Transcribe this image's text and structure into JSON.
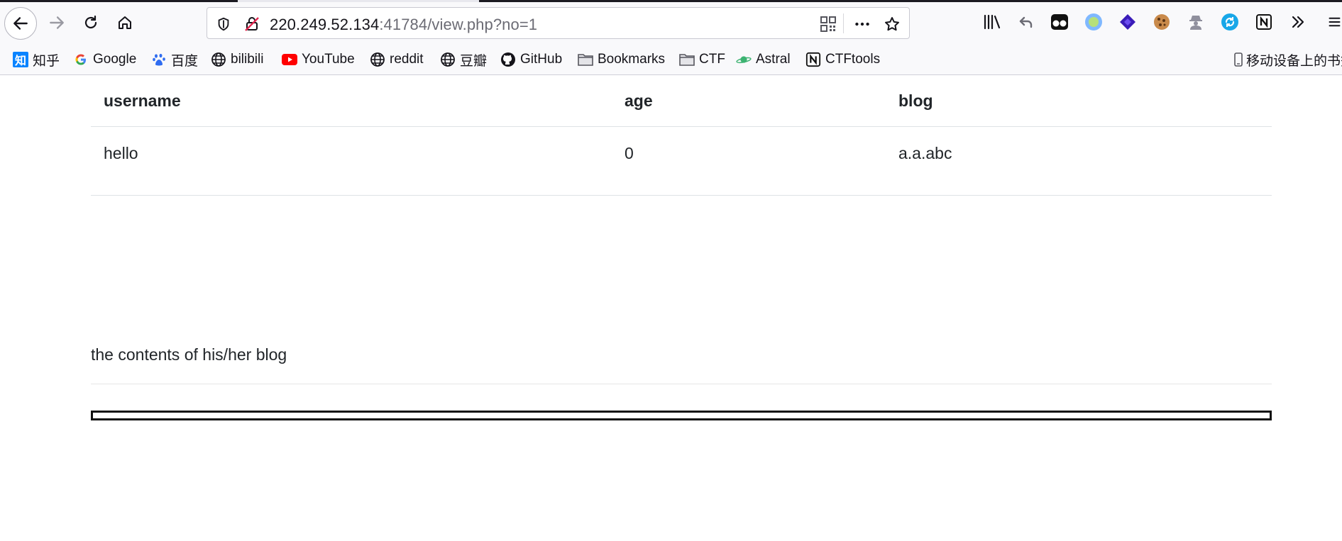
{
  "browser": {
    "url_host": "220.249.52.134",
    "url_rest": ":41784/view.php?no=1",
    "bookmarks": [
      {
        "label": "知乎",
        "icon": "zhihu-icon"
      },
      {
        "label": "Google",
        "icon": "google-icon"
      },
      {
        "label": "百度",
        "icon": "baidu-icon"
      },
      {
        "label": "bilibili",
        "icon": "globe-icon"
      },
      {
        "label": "YouTube",
        "icon": "youtube-icon"
      },
      {
        "label": "reddit",
        "icon": "globe-icon"
      },
      {
        "label": "豆瓣",
        "icon": "globe-icon"
      },
      {
        "label": "GitHub",
        "icon": "github-icon"
      },
      {
        "label": "Bookmarks",
        "icon": "folder-icon"
      },
      {
        "label": "CTF",
        "icon": "folder-icon"
      },
      {
        "label": "Astral",
        "icon": "astral-icon"
      },
      {
        "label": "CTFtools",
        "icon": "notion-icon"
      }
    ],
    "mobile_bookmarks": "移动设备上的书签",
    "zhihu_glyph": "知",
    "notion_glyph": "N"
  },
  "colors": {
    "youtube": "#ff0000",
    "folder": "#8f8f9d",
    "astral": "#3cb371",
    "accent_blue": "#0a84ff"
  },
  "table": {
    "headers": [
      "username",
      "age",
      "blog"
    ],
    "rows": [
      [
        "hello",
        "0",
        "a.a.abc"
      ]
    ]
  },
  "blog_contents_label": "the contents of his/her blog"
}
